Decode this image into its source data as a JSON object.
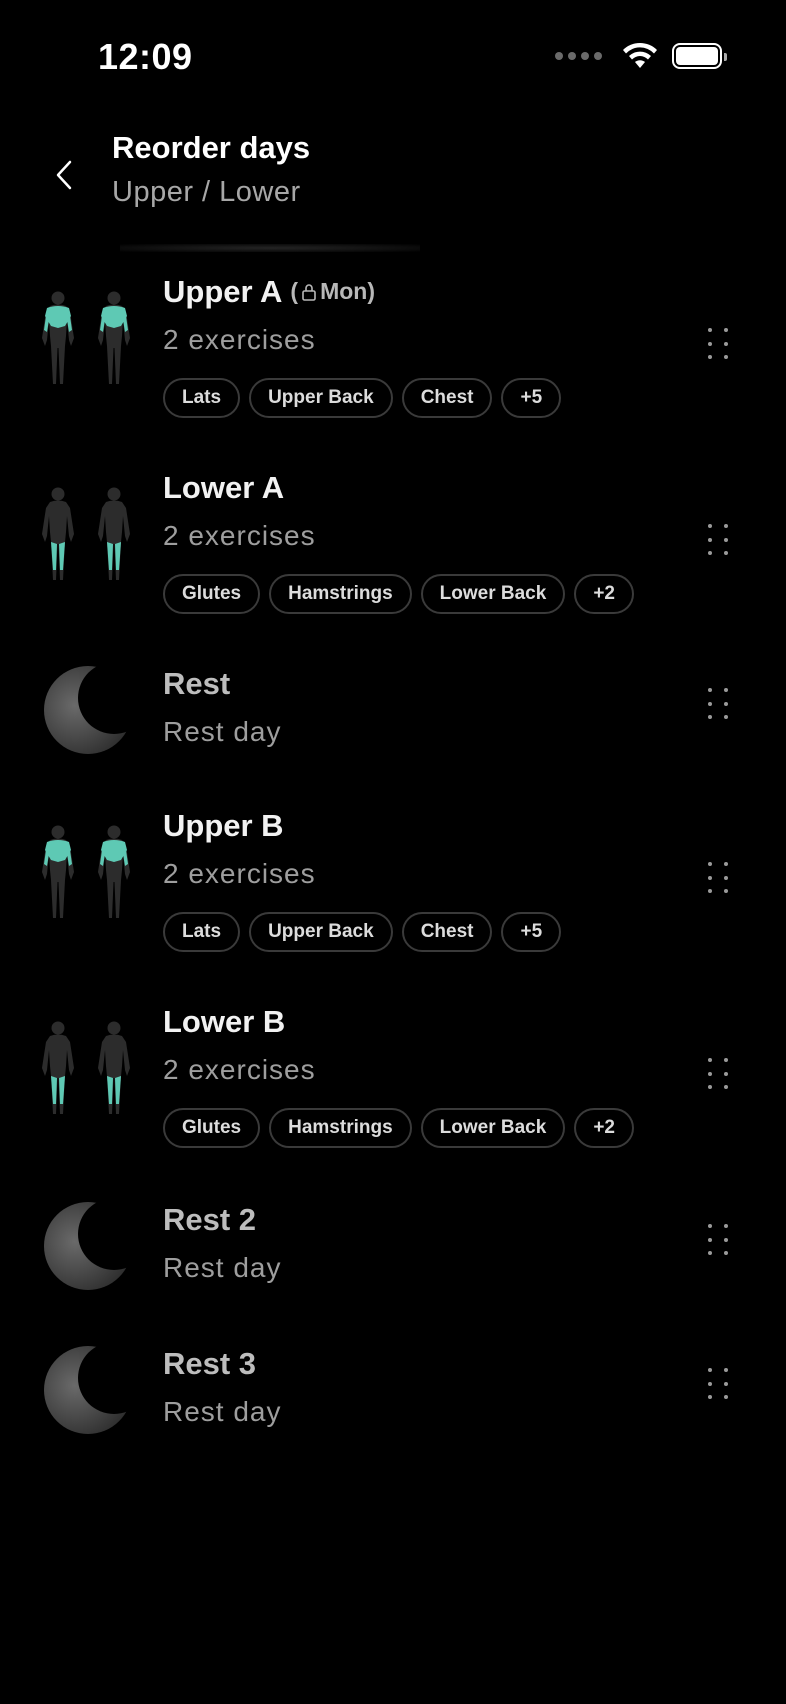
{
  "status_bar": {
    "time": "12:09"
  },
  "header": {
    "title": "Reorder days",
    "subtitle": "Upper / Lower"
  },
  "days": [
    {
      "name": "Upper A",
      "badge": "Mon",
      "subtitle": "2 exercises",
      "tags": [
        "Lats",
        "Upper Back",
        "Chest",
        "+5"
      ],
      "icon": "upper-body-muscle-icon"
    },
    {
      "name": "Lower A",
      "subtitle": "2 exercises",
      "tags": [
        "Glutes",
        "Hamstrings",
        "Lower Back",
        "+2"
      ],
      "icon": "lower-body-muscle-icon"
    },
    {
      "name": "Rest",
      "subtitle": "Rest day",
      "icon": "moon-icon"
    },
    {
      "name": "Upper B",
      "subtitle": "2 exercises",
      "tags": [
        "Lats",
        "Upper Back",
        "Chest",
        "+5"
      ],
      "icon": "upper-body-muscle-icon"
    },
    {
      "name": "Lower B",
      "subtitle": "2 exercises",
      "tags": [
        "Glutes",
        "Hamstrings",
        "Lower Back",
        "+2"
      ],
      "icon": "lower-body-muscle-icon"
    },
    {
      "name": "Rest 2",
      "subtitle": "Rest day",
      "icon": "moon-icon"
    },
    {
      "name": "Rest 3",
      "subtitle": "Rest day",
      "icon": "moon-icon"
    }
  ],
  "colors": {
    "background": "#000000",
    "muscle_highlight": "#5ec9b4",
    "tag_border": "#3a3a3a"
  }
}
